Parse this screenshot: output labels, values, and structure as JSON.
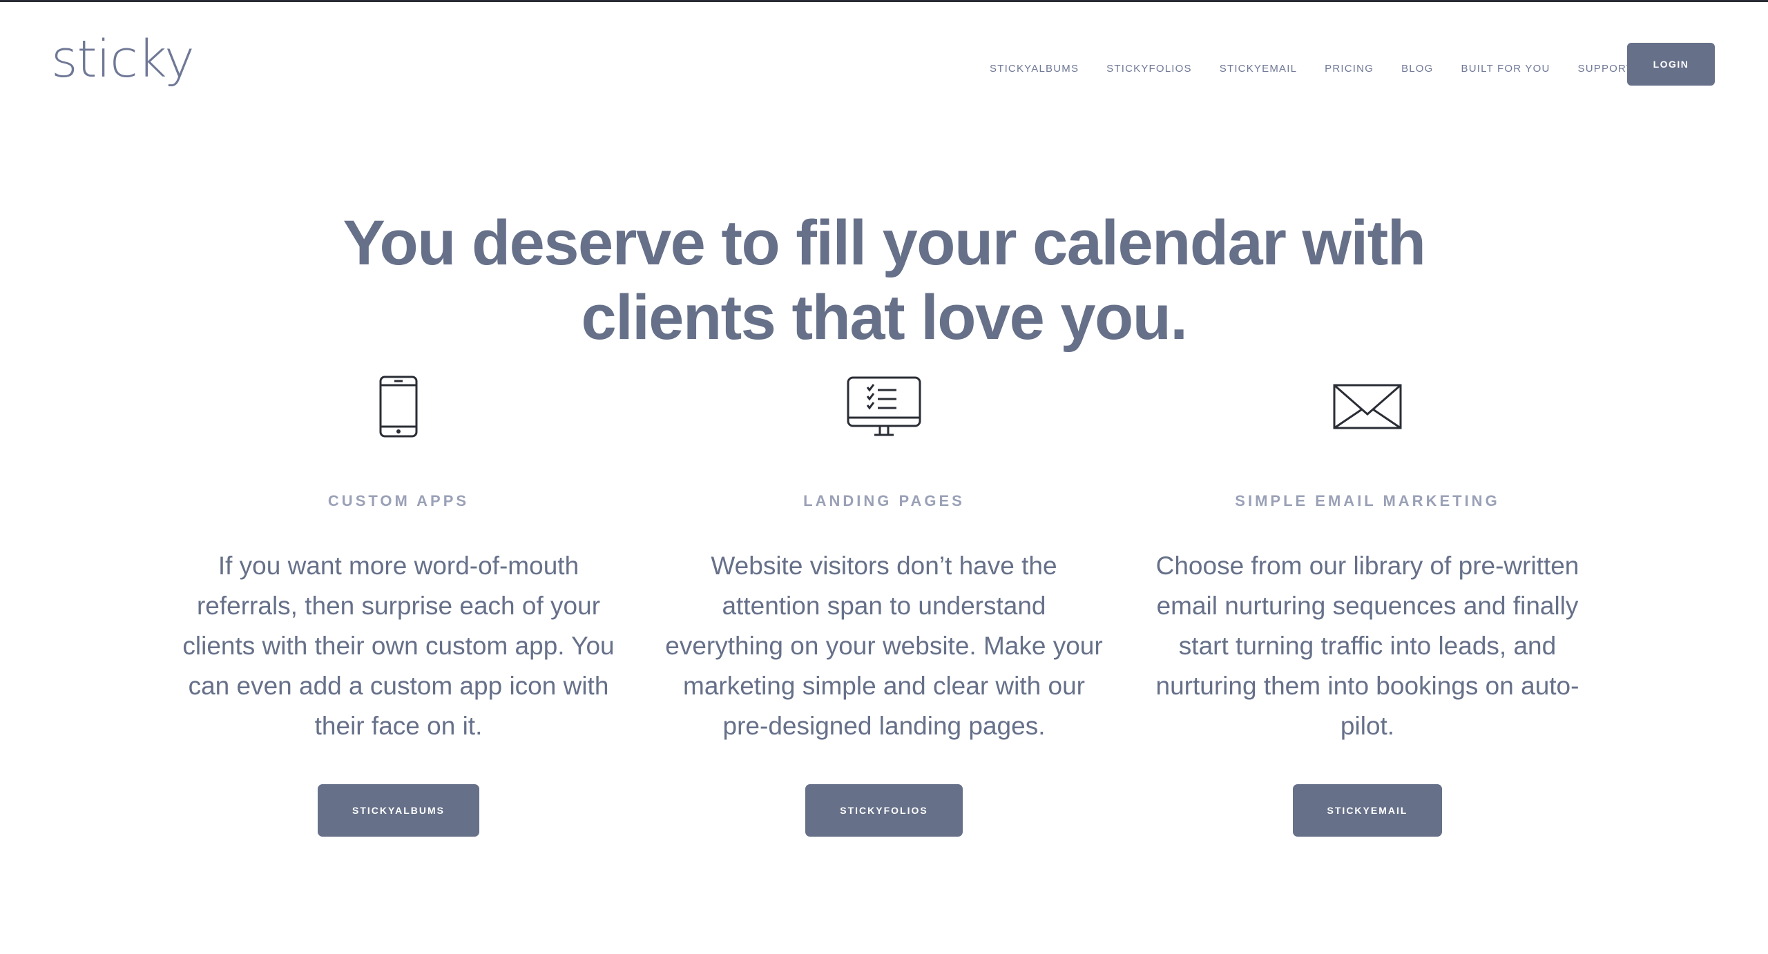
{
  "header": {
    "logo": "sticky",
    "nav": [
      "STICKYALBUMS",
      "STICKYFOLIOS",
      "STICKYEMAIL",
      "PRICING",
      "BLOG",
      "BUILT FOR YOU",
      "SUPPORT"
    ],
    "login_label": "LOGIN"
  },
  "hero": {
    "line1": "You deserve to fill your calendar with",
    "line2": "clients that love you."
  },
  "features": [
    {
      "icon": "smartphone-icon",
      "title": "CUSTOM APPS",
      "description": "If you want more word-of-mouth referrals, then surprise each of your clients with their own custom app. You can even add a custom app icon with their face on it.",
      "button": "STICKYALBUMS"
    },
    {
      "icon": "monitor-checklist-icon",
      "title": "LANDING PAGES",
      "description": "Website visitors don’t have the attention span to understand everything on your website. Make your marketing simple and clear with our pre-designed landing pages.",
      "button": "STICKYFOLIOS"
    },
    {
      "icon": "envelope-icon",
      "title": "SIMPLE EMAIL MARKETING",
      "description": "Choose from our library of pre-written email nurturing sequences and finally start turning traffic into leads, and nurturing them into bookings on auto-pilot.",
      "button": "STICKYEMAIL"
    }
  ],
  "colors": {
    "primary": "#667089",
    "subtitle": "#9aa1b7",
    "icon": "#2a2d35"
  }
}
